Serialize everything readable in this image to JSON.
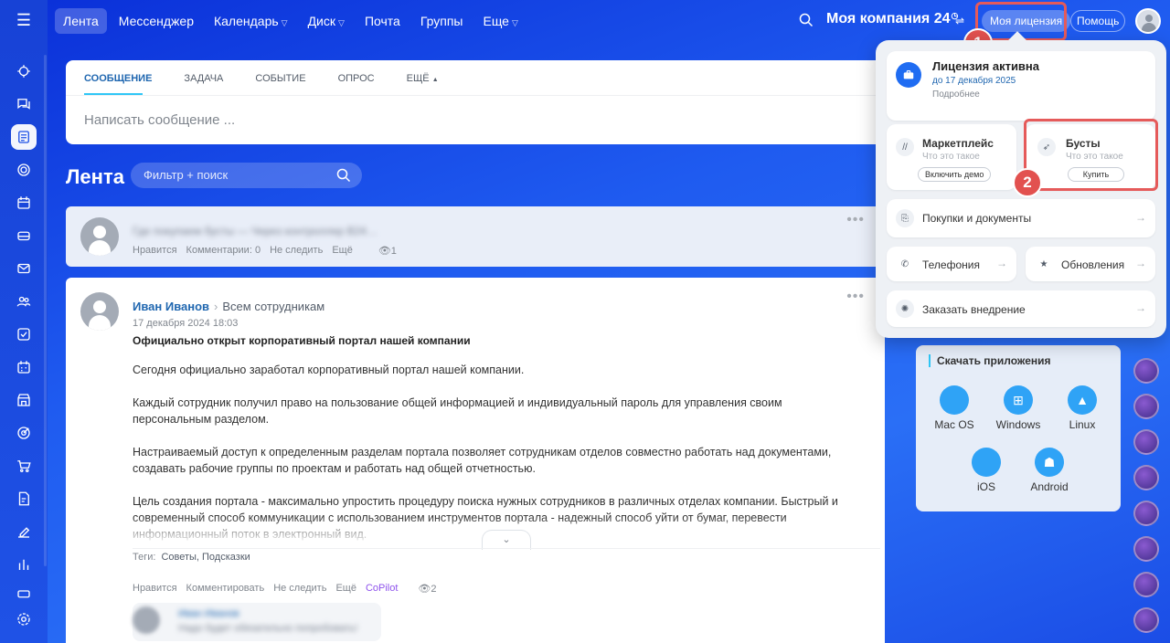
{
  "topnav": {
    "items": [
      {
        "label": "Лента",
        "active": true,
        "dropdown": false
      },
      {
        "label": "Мессенджер",
        "active": false,
        "dropdown": false
      },
      {
        "label": "Календарь",
        "active": false,
        "dropdown": true
      },
      {
        "label": "Диск",
        "active": false,
        "dropdown": true
      },
      {
        "label": "Почта",
        "active": false,
        "dropdown": false
      },
      {
        "label": "Группы",
        "active": false,
        "dropdown": false
      },
      {
        "label": "Еще",
        "active": false,
        "dropdown": true
      }
    ],
    "company": "Моя компания 24",
    "license_button": "Моя лицензия",
    "help_button": "Помощь"
  },
  "badges": [
    "1",
    "2"
  ],
  "composer": {
    "tabs": [
      "СООБЩЕНИЕ",
      "ЗАДАЧА",
      "СОБЫТИЕ",
      "ОПРОС",
      "ЕЩЁ"
    ],
    "placeholder": "Написать сообщение ..."
  },
  "feed": {
    "title": "Лента",
    "filter_placeholder": "Фильтр + поиск"
  },
  "post1": {
    "preview": "Где покупаем бусты — Через контроллер В24…",
    "actions": [
      "Нравится",
      "Комментарии: 0",
      "Не следить",
      "Ещё"
    ],
    "views": "1"
  },
  "post2": {
    "author": "Иван Иванов",
    "recipients": "Всем сотрудникам",
    "date": "17 декабря 2024 18:03",
    "title": "Официально открыт корпоративный портал нашей компании",
    "paragraphs": [
      "Сегодня официально заработал корпоративный портал нашей компании.",
      "Каждый сотрудник получил право на пользование общей информацией и индивидуальный пароль для управления своим персональным разделом.",
      "Настраиваемый доступ к определенным разделам портала позволяет сотрудникам отделов совместно работать над документами, создавать рабочие группы по проектам и работать над общей отчетностью.",
      "Цель создания портала - максимально упростить процедуру поиска нужных сотрудников в различных отделах компании. Быстрый и современный способ коммуникации с использованием инструментов портала - надежный способ уйти от бумаг, перевести информационный поток в электронный вид."
    ],
    "tags_label": "Теги:",
    "tags": "Советы, Подсказки",
    "actions": [
      "Нравится",
      "Комментировать",
      "Не следить",
      "Ещё"
    ],
    "copilot": "CoPilot",
    "views": "2",
    "comment_author": "Иван Иванов",
    "comment_text": "Надо будет обязательно попробовать!"
  },
  "license_popup": {
    "title": "Лицензия активна",
    "date": "до 17 декабря 2025",
    "more": "Подробнее",
    "market": {
      "title": "Маркетплейс",
      "sub": "Что это такое",
      "button": "Включить демо"
    },
    "boosts": {
      "title": "Бусты",
      "sub": "Что это такое",
      "button": "Купить"
    },
    "rows": {
      "purchases": "Покупки и документы",
      "telephony": "Телефония",
      "updates": "Обновления",
      "implementation": "Заказать внедрение"
    }
  },
  "apps": {
    "title": "Скачать приложения",
    "items": [
      "Mac OS",
      "Windows",
      "Linux",
      "iOS",
      "Android"
    ]
  },
  "colors": {
    "accent": "#1f6cf2",
    "highlight": "#e55a5a",
    "copilot": "#8e52ec"
  }
}
